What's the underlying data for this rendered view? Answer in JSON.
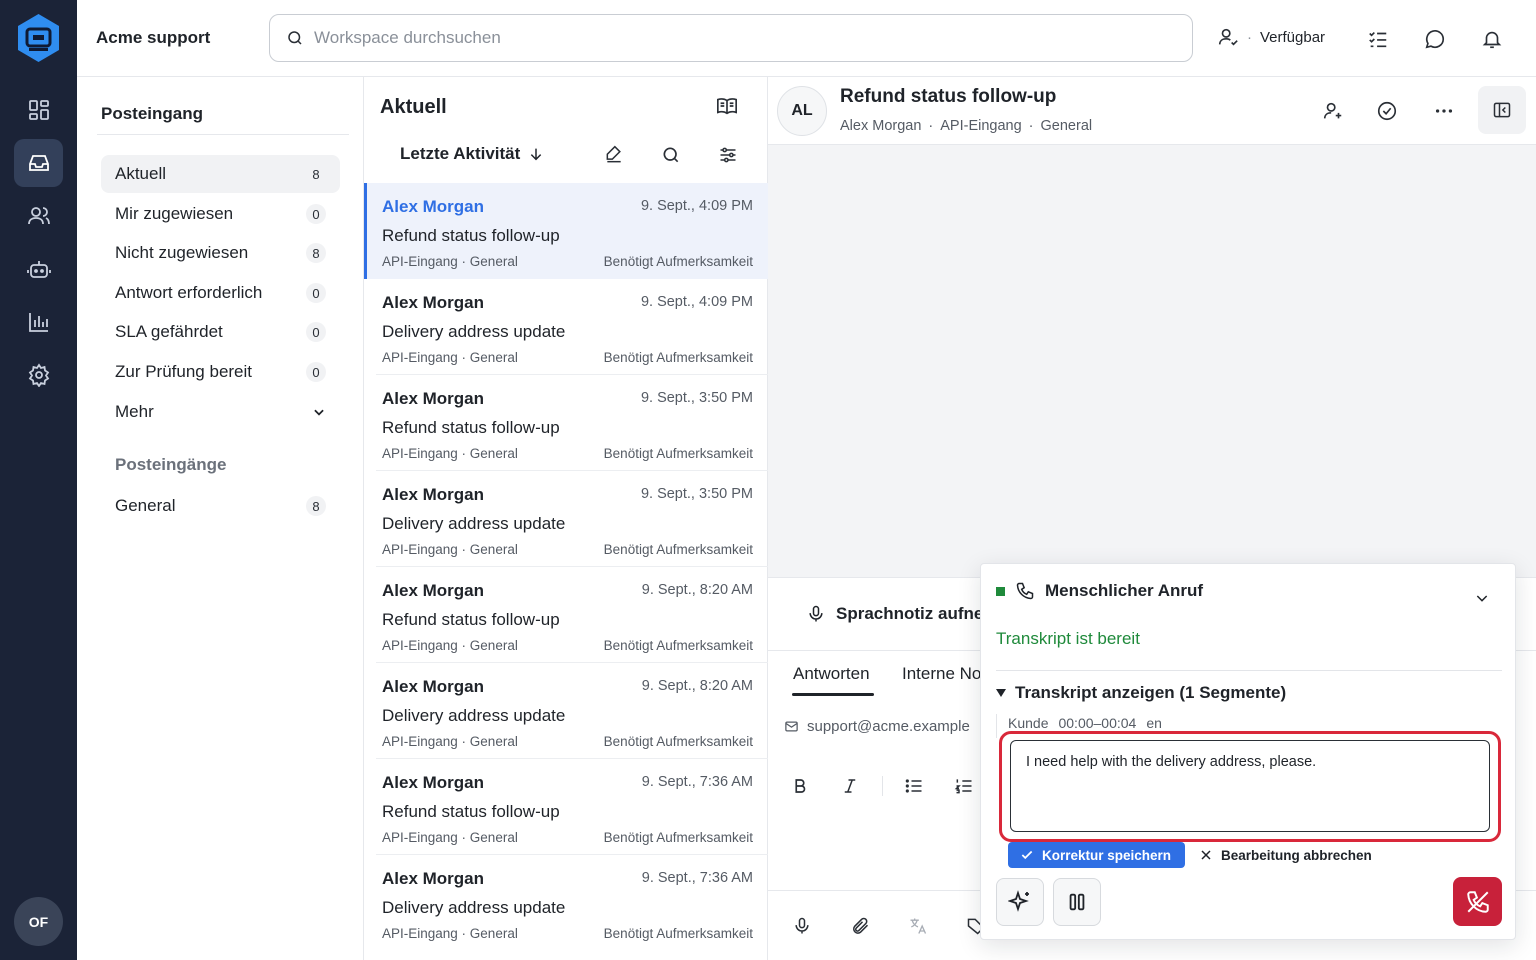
{
  "app": {
    "brand": "Acme support"
  },
  "search": {
    "placeholder": "Workspace durchsuchen"
  },
  "topbar": {
    "status": "Verfügbar"
  },
  "rail": {
    "items": [
      "dashboard-icon",
      "inbox-icon",
      "contacts-icon",
      "bot-icon",
      "reports-icon",
      "settings-icon"
    ],
    "active": "inbox-icon",
    "user_initials": "OF"
  },
  "sidebar": {
    "title": "Posteingang",
    "items": [
      {
        "label": "Aktuell",
        "count": "8"
      },
      {
        "label": "Mir zugewiesen",
        "count": "0"
      },
      {
        "label": "Nicht zugewiesen",
        "count": "8"
      },
      {
        "label": "Antwort erforderlich",
        "count": "0"
      },
      {
        "label": "SLA gefährdet",
        "count": "0"
      },
      {
        "label": "Zur Prüfung bereit",
        "count": "0"
      }
    ],
    "more_label": "Mehr",
    "section_title": "Posteingänge",
    "inboxes": [
      {
        "label": "General",
        "count": "8"
      }
    ]
  },
  "list": {
    "title": "Aktuell",
    "sort_label": "Letzte Aktivität",
    "conversations": [
      {
        "name": "Alex Morgan",
        "time": "9. Sept., 4:09 PM",
        "subject": "Refund status follow-up",
        "meta": "API-Eingang · General",
        "flag": "Benötigt Aufmerksamkeit"
      },
      {
        "name": "Alex Morgan",
        "time": "9. Sept., 4:09 PM",
        "subject": "Delivery address update",
        "meta": "API-Eingang · General",
        "flag": "Benötigt Aufmerksamkeit"
      },
      {
        "name": "Alex Morgan",
        "time": "9. Sept., 3:50 PM",
        "subject": "Refund status follow-up",
        "meta": "API-Eingang · General",
        "flag": "Benötigt Aufmerksamkeit"
      },
      {
        "name": "Alex Morgan",
        "time": "9. Sept., 3:50 PM",
        "subject": "Delivery address update",
        "meta": "API-Eingang · General",
        "flag": "Benötigt Aufmerksamkeit"
      },
      {
        "name": "Alex Morgan",
        "time": "9. Sept., 8:20 AM",
        "subject": "Refund status follow-up",
        "meta": "API-Eingang · General",
        "flag": "Benötigt Aufmerksamkeit"
      },
      {
        "name": "Alex Morgan",
        "time": "9. Sept., 8:20 AM",
        "subject": "Delivery address update",
        "meta": "API-Eingang · General",
        "flag": "Benötigt Aufmerksamkeit"
      },
      {
        "name": "Alex Morgan",
        "time": "9. Sept., 7:36 AM",
        "subject": "Refund status follow-up",
        "meta": "API-Eingang · General",
        "flag": "Benötigt Aufmerksamkeit"
      },
      {
        "name": "Alex Morgan",
        "time": "9. Sept., 7:36 AM",
        "subject": "Delivery address update",
        "meta": "API-Eingang · General",
        "flag": "Benötigt Aufmerksamkeit"
      }
    ]
  },
  "detail": {
    "avatar": "AL",
    "title": "Refund status follow-up",
    "contact": "Alex Morgan",
    "inbox": "API-Eingang",
    "team": "General",
    "sep": "·"
  },
  "compose": {
    "voice_note": "Sprachnotiz aufne",
    "tab_reply": "Antworten",
    "tab_note": "Interne No",
    "from": "support@acme.example"
  },
  "call": {
    "title": "Menschlicher Anruf",
    "status": "Transkript ist bereit",
    "transcript_toggle": "Transkript anzeigen (1 Segmente)",
    "speaker": "Kunde",
    "range": "00:00–00:04",
    "lang": "en",
    "segment_text": "I need help with the delivery address, please.",
    "save_label": "Korrektur speichern",
    "cancel_label": "Bearbeitung abbrechen",
    "live_color": "#1f8a3b",
    "hangup_color": "#c8213a"
  }
}
